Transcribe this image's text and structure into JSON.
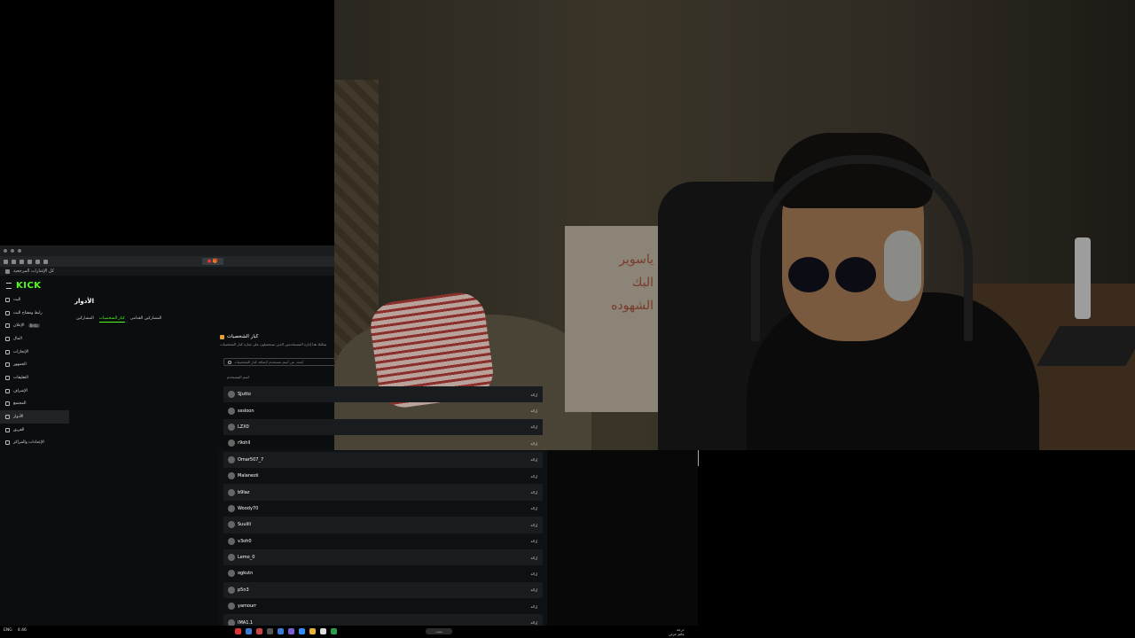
{
  "browser": {
    "bookmarks_label": "كل الإشارات المرجعية",
    "tab_label": "● 🎁"
  },
  "kick": {
    "logo": "KICK",
    "page_title": "الأدوار",
    "sidebar": [
      {
        "label": "البث",
        "name": "sidebar-item-stream"
      },
      {
        "label": "رابط ومفتاح البث",
        "name": "sidebar-item-stream-key"
      },
      {
        "label": "الإعلان",
        "badge": "Beta",
        "name": "sidebar-item-ads"
      },
      {
        "label": "المال",
        "name": "sidebar-item-money"
      },
      {
        "label": "الإنجازات",
        "name": "sidebar-item-achievements"
      },
      {
        "label": "الجمهور",
        "name": "sidebar-item-audience"
      },
      {
        "label": "التعليقات",
        "name": "sidebar-item-comments"
      },
      {
        "label": "الإشراف",
        "name": "sidebar-item-moderation"
      },
      {
        "label": "المجتمع",
        "name": "sidebar-item-community"
      },
      {
        "label": "الأدوار",
        "name": "sidebar-item-roles",
        "active": true
      },
      {
        "label": "الفريق",
        "name": "sidebar-item-team"
      },
      {
        "label": "الإعدادات والمراكز",
        "name": "sidebar-item-settings"
      }
    ],
    "subtabs": [
      "المشاركين",
      "كبار الشخصيات",
      "المشاركين القدامى"
    ],
    "vip": {
      "title": "كبار الشخصيات",
      "description": "يمكنك هنا إدارة المستخدمين الذين سيحصلون على شارة كبار الشخصيات",
      "search_placeholder": "ابحث عن اسم مستخدم لإضافة كبار الشخصيات",
      "column_header": "اسم المستخدم",
      "action_label": "إزالة",
      "users": [
        "SJutto",
        "sssloon",
        "LZX0",
        "r9ohll",
        "Omar507_7",
        "Malanezii",
        "b9laz",
        "Woody70",
        "Suulili",
        "v3oh0",
        "Lemo_0",
        "ogkutn",
        "p5n3",
        "yamourr",
        "IMA1.1"
      ]
    }
  },
  "webcam": {
    "paper_text": "ياسوير\nالبك\nالشهوده"
  },
  "taskbar": {
    "left_text": [
      "ENG",
      "4:46"
    ],
    "search_label": "بحث",
    "weather": [
      "درجة",
      "غائم جزئي"
    ]
  }
}
